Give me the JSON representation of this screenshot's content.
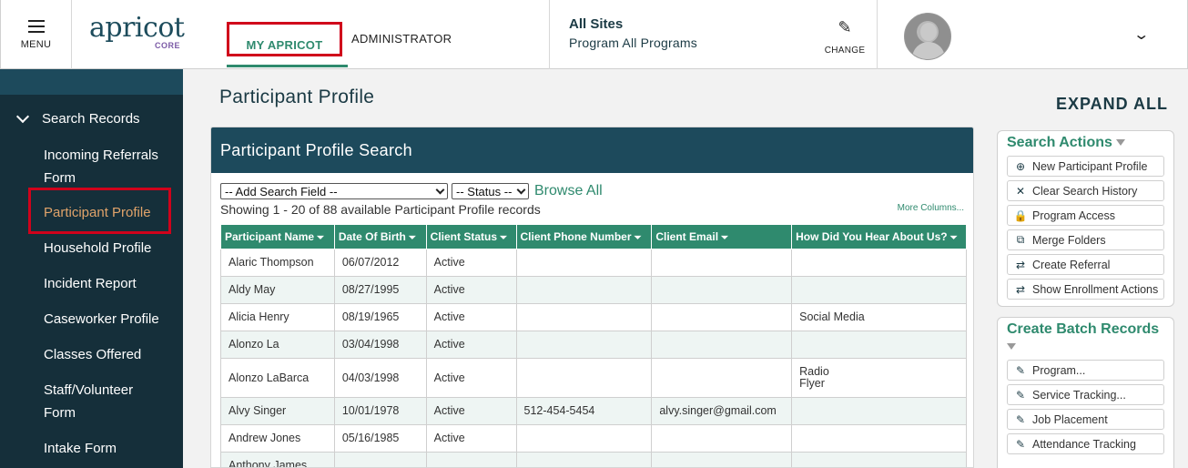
{
  "header": {
    "menu_label": "MENU",
    "logo_text": "apricot",
    "logo_sub": "CORE",
    "tab_my": "MY APRICOT",
    "tab_admin": "ADMINISTRATOR",
    "sites_title": "All Sites",
    "sites_program": "Program All Programs",
    "change_label": "CHANGE"
  },
  "sidebar": {
    "section": "Search Records",
    "items": [
      {
        "label": "Incoming Referrals Form"
      },
      {
        "label": "Participant Profile"
      },
      {
        "label": "Household Profile"
      },
      {
        "label": "Incident Report"
      },
      {
        "label": "Caseworker Profile"
      },
      {
        "label": "Classes Offered"
      },
      {
        "label": "Staff/Volunteer Form"
      },
      {
        "label": "Intake Form"
      }
    ]
  },
  "main": {
    "page_title": "Participant Profile",
    "expand_all": "EXPAND ALL",
    "panel_title": "Participant Profile Search",
    "add_field": "-- Add Search Field --",
    "status": "-- Status --",
    "browse_all": "Browse All",
    "showing": "Showing 1 - 20 of 88 available Participant Profile records",
    "more_columns": "More Columns...",
    "columns": [
      "Participant Name",
      "Date Of Birth",
      "Client Status",
      "Client Phone Number",
      "Client Email",
      "How Did You Hear About Us?"
    ],
    "rows": [
      {
        "name": "Alaric Thompson",
        "dob": "06/07/2012",
        "status": "Active",
        "phone": "",
        "email": "",
        "hear": ""
      },
      {
        "name": "Aldy May",
        "dob": "08/27/1995",
        "status": "Active",
        "phone": "",
        "email": "",
        "hear": ""
      },
      {
        "name": "Alicia Henry",
        "dob": "08/19/1965",
        "status": "Active",
        "phone": "",
        "email": "",
        "hear": "Social Media"
      },
      {
        "name": "Alonzo La",
        "dob": "03/04/1998",
        "status": "Active",
        "phone": "",
        "email": "",
        "hear": ""
      },
      {
        "name": "Alonzo LaBarca",
        "dob": "04/03/1998",
        "status": "Active",
        "phone": "",
        "email": "",
        "hear": "Radio",
        "hear2": "Flyer"
      },
      {
        "name": "Alvy Singer",
        "dob": "10/01/1978",
        "status": "Active",
        "phone": "512-454-5454",
        "email": "alvy.singer@gmail.com",
        "hear": ""
      },
      {
        "name": "Andrew Jones",
        "dob": "05/16/1985",
        "status": "Active",
        "phone": "",
        "email": "",
        "hear": ""
      },
      {
        "name": "Anthony James",
        "dob": "",
        "status": "",
        "phone": "",
        "email": "",
        "hear": ""
      }
    ]
  },
  "search_actions": {
    "title": "Search Actions",
    "buttons": [
      {
        "label": "New Participant Profile",
        "icon": "plus-circle-icon"
      },
      {
        "label": "Clear Search History",
        "icon": "x-icon"
      },
      {
        "label": "Program Access",
        "icon": "lock-icon"
      },
      {
        "label": "Merge Folders",
        "icon": "merge-icon"
      },
      {
        "label": "Create Referral",
        "icon": "swap-arrows-icon"
      },
      {
        "label": "Show Enrollment Actions",
        "icon": "swap-arrows-icon"
      }
    ]
  },
  "batch": {
    "title": "Create Batch Records",
    "buttons": [
      {
        "label": "Program...",
        "icon": "pencil-icon"
      },
      {
        "label": "Service Tracking...",
        "icon": "pencil-icon"
      },
      {
        "label": "Job Placement",
        "icon": "pencil-icon"
      },
      {
        "label": "Attendance Tracking",
        "icon": "pencil-icon"
      }
    ]
  }
}
